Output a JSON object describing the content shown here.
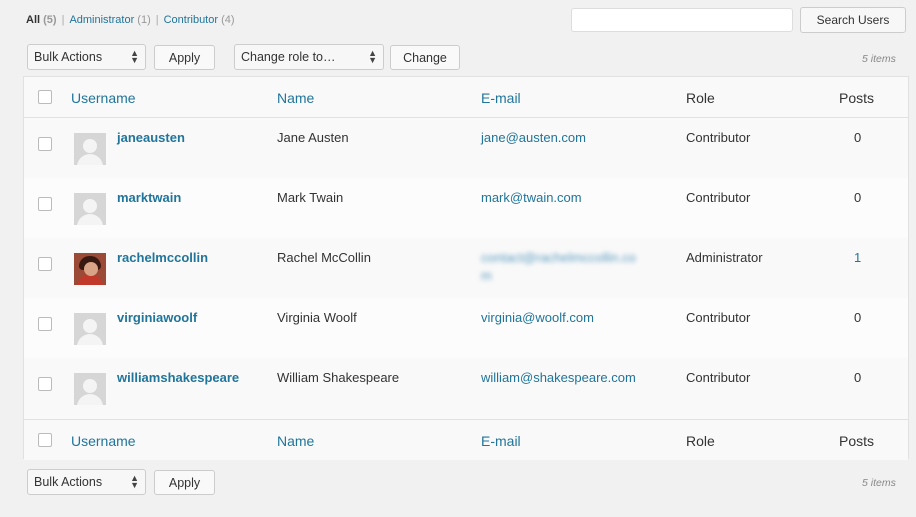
{
  "filters": {
    "all": {
      "label": "All",
      "count": "(5)"
    },
    "administrator": {
      "label": "Administrator",
      "count": "(1)"
    },
    "contributor": {
      "label": "Contributor",
      "count": "(4)"
    },
    "separator": "|"
  },
  "search": {
    "placeholder": "",
    "button_label": "Search Users"
  },
  "top_nav": {
    "bulk_actions": "Bulk Actions",
    "apply": "Apply",
    "change_role": "Change role to…",
    "change": "Change",
    "items_count": "5 items"
  },
  "bottom_nav": {
    "bulk_actions": "Bulk Actions",
    "apply": "Apply",
    "items_count": "5 items"
  },
  "columns": {
    "username": "Username",
    "name": "Name",
    "email": "E-mail",
    "role": "Role",
    "posts": "Posts"
  },
  "users": [
    {
      "username": "janeausten",
      "name": "Jane Austen",
      "email": "jane@austen.com",
      "role": "Contributor",
      "posts": "0",
      "avatar": "default"
    },
    {
      "username": "marktwain",
      "name": "Mark Twain",
      "email": "mark@twain.com",
      "role": "Contributor",
      "posts": "0",
      "avatar": "default"
    },
    {
      "username": "rachelmccollin",
      "name": "Rachel McCollin",
      "email": "contact@rachelmccollin.co",
      "email_line2": "m",
      "role": "Administrator",
      "posts": "1",
      "avatar": "photo"
    },
    {
      "username": "virginiawoolf",
      "name": "Virginia Woolf",
      "email": "virginia@woolf.com",
      "role": "Contributor",
      "posts": "0",
      "avatar": "default"
    },
    {
      "username": "williamshakespeare",
      "name": "William Shakespeare",
      "email": "william@shakespeare.com",
      "role": "Contributor",
      "posts": "0",
      "avatar": "default"
    }
  ],
  "colors": {
    "link": "#21759b",
    "background": "#f1f1f1"
  }
}
